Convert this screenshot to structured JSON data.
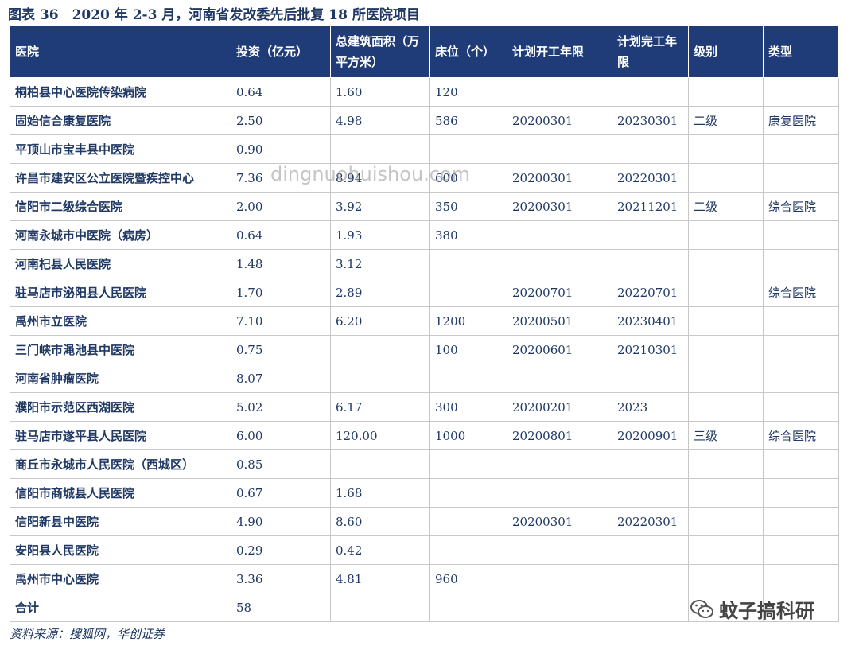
{
  "title": "图表 36　2020 年 2-3 月，河南省发改委先后批复 18 所医院项目",
  "headers": [
    "医院",
    "投资（亿元）",
    "总建筑面积（万平方米）",
    "床位（个）",
    "计划开工年限",
    "计划完工年限",
    "级别",
    "类型"
  ],
  "rows": [
    [
      "桐柏县中心医院传染病院",
      "0.64",
      "1.60",
      "120",
      "",
      "",
      "",
      ""
    ],
    [
      "固始信合康复医院",
      "2.50",
      "4.98",
      "586",
      "20200301",
      "20230301",
      "二级",
      "康复医院"
    ],
    [
      "平顶山市宝丰县中医院",
      "0.90",
      "",
      "",
      "",
      "",
      "",
      ""
    ],
    [
      "许昌市建安区公立医院暨疾控中心",
      "7.36",
      "8.94",
      "600",
      "20200301",
      "20220301",
      "",
      ""
    ],
    [
      "信阳市二级综合医院",
      "2.00",
      "3.92",
      "350",
      "20200301",
      "20211201",
      "二级",
      "综合医院"
    ],
    [
      "河南永城市中医院（病房）",
      "0.64",
      "1.93",
      "380",
      "",
      "",
      "",
      ""
    ],
    [
      "河南杞县人民医院",
      "1.48",
      "3.12",
      "",
      "",
      "",
      "",
      ""
    ],
    [
      "驻马店市泌阳县人民医院",
      "1.70",
      "2.89",
      "",
      "20200701",
      "20220701",
      "",
      "综合医院"
    ],
    [
      "禹州市立医院",
      "7.10",
      "6.20",
      "1200",
      "20200501",
      "20230401",
      "",
      ""
    ],
    [
      "三门峡市渑池县中医院",
      "0.75",
      "",
      "100",
      "20200601",
      "20210301",
      "",
      ""
    ],
    [
      "河南省肿瘤医院",
      "8.07",
      "",
      "",
      "",
      "",
      "",
      ""
    ],
    [
      "濮阳市示范区西湖医院",
      "5.02",
      "6.17",
      "300",
      "20200201",
      "2023",
      "",
      ""
    ],
    [
      "驻马店市遂平县人民医院",
      "6.00",
      "120.00",
      "1000",
      "20200801",
      "20200901",
      "三级",
      "综合医院"
    ],
    [
      "商丘市永城市人民医院（西城区）",
      "0.85",
      "",
      "",
      "",
      "",
      "",
      ""
    ],
    [
      "信阳市商城县人民医院",
      "0.67",
      "1.68",
      "",
      "",
      "",
      "",
      ""
    ],
    [
      "信阳新县中医院",
      "4.90",
      "8.60",
      "",
      "20200301",
      "20220301",
      "",
      ""
    ],
    [
      "安阳县人民医院",
      "0.29",
      "0.42",
      "",
      "",
      "",
      "",
      ""
    ],
    [
      "禹州市中心医院",
      "3.36",
      "4.81",
      "960",
      "",
      "",
      "",
      ""
    ],
    [
      "合计",
      "58",
      "",
      "",
      "",
      "",
      "",
      ""
    ]
  ],
  "watermark": "dingnuohuishou.com",
  "brand": "蚊子搞科研",
  "source": "资料来源：搜狐网，华创证券"
}
